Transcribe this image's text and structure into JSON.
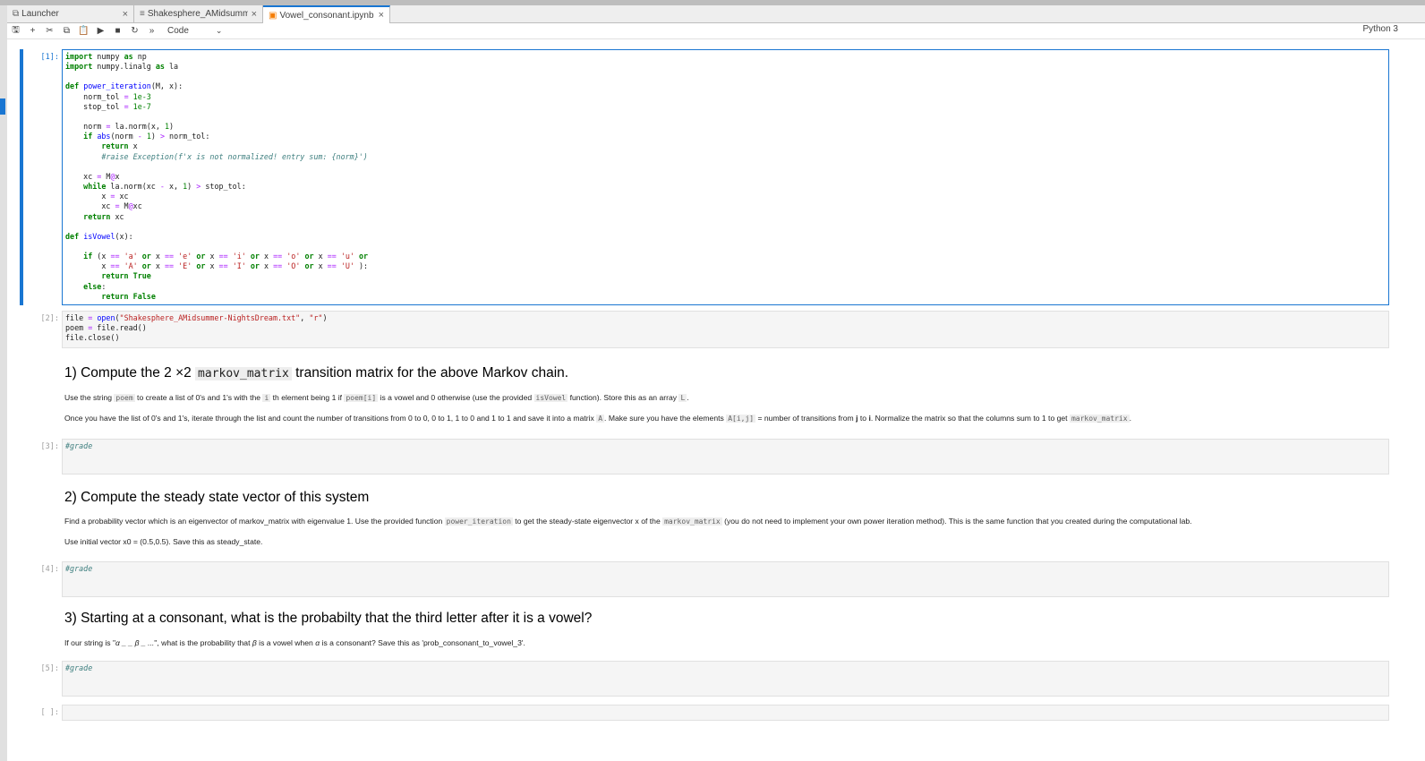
{
  "tabs": [
    {
      "label": "Launcher",
      "icon": "launcher-icon",
      "close": "×"
    },
    {
      "label": "Shakesphere_AMidsummer-N",
      "icon": "text-file-icon",
      "close": "×"
    },
    {
      "label": "Vowel_consonant.ipynb",
      "icon": "notebook-icon",
      "close": "×"
    }
  ],
  "toolbar": {
    "icons": [
      "save-icon",
      "add-cell-icon",
      "cut-icon",
      "copy-icon",
      "paste-icon",
      "run-icon",
      "stop-icon",
      "restart-icon",
      "fast-forward-icon"
    ],
    "cell_type": "Code",
    "kernel": "Python 3"
  },
  "cells": {
    "c1": {
      "prompt": "[1]:"
    },
    "c2": {
      "prompt": "[2]:"
    },
    "c3": {
      "prompt": "[3]:",
      "code": "#grade"
    },
    "c4": {
      "prompt": "[4]:",
      "code": "#grade"
    },
    "c5": {
      "prompt": "[5]:",
      "code": "#grade"
    },
    "c6": {
      "prompt": "[ ]:"
    }
  },
  "md1": {
    "heading_pre": "1) Compute the 2 ×2 ",
    "heading_code": "markov_matrix",
    "heading_post": " transition matrix for the above Markov chain.",
    "p1": [
      "Use the string ",
      "poem",
      " to create a list of 0's and 1's with the ",
      "i",
      " th element being 1 if ",
      "poem[i]",
      " is a vowel and 0 otherwise (use the provided ",
      "isVowel",
      " function). Store this as an array ",
      "L",
      "."
    ],
    "p2": [
      "Once you have the list of 0's and 1's, iterate through the list and count the number of transitions from 0 to 0, 0 to 1, 1 to 0 and 1 to 1 and save it into a matrix ",
      "A",
      ". Make sure you have the elements ",
      "A[i,j]",
      " = number of transitions from ",
      "j",
      " to ",
      "i",
      ". Normalize the matrix so that the columns sum to 1 to get ",
      "markov_matrix",
      "."
    ]
  },
  "md2": {
    "heading": "2) Compute the steady state vector of this system",
    "p1": [
      "Find a probability vector which is an eigenvector of markov_matrix with eigenvalue 1. Use the provided function ",
      "power_iteration",
      " to get the steady-state eigenvector x of the ",
      "markov_matrix",
      " (you do not need to implement your own power iteration method). This is the same function that you created during the computational lab."
    ],
    "p2": "Use initial vector x0 = (0.5,0.5). Save this as steady_state."
  },
  "md3": {
    "heading": "3) Starting at a consonant, what is the probabilty that the third letter after it is a vowel?",
    "p1": [
      "If our string is \"",
      "α _ _ β _ ...",
      "\", what is the probability that ",
      "β",
      " is a vowel when ",
      "α",
      " is a consonant? Save this as 'prob_consonant_to_vowel_3'."
    ]
  }
}
